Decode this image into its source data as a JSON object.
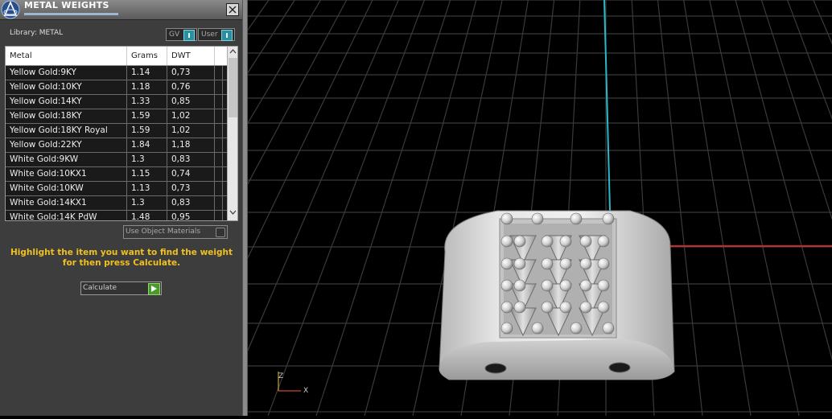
{
  "panel": {
    "title": "METAL WEIGHTS",
    "library_label": "Library: METAL",
    "toggles": {
      "gv": "GV",
      "user": "User"
    },
    "table": {
      "columns": [
        "Metal",
        "Grams",
        "DWT"
      ],
      "rows": [
        [
          "Yellow Gold:9KY",
          "1.14",
          "0,73"
        ],
        [
          "Yellow Gold:10KY",
          "1.18",
          "0,76"
        ],
        [
          "Yellow Gold:14KY",
          "1.33",
          "0,85"
        ],
        [
          "Yellow Gold:18KY",
          "1.59",
          "1,02"
        ],
        [
          "Yellow Gold:18KY Royal",
          "1.59",
          "1,02"
        ],
        [
          "Yellow Gold:22KY",
          "1.84",
          "1,18"
        ],
        [
          "White Gold:9KW",
          "1.3",
          "0,83"
        ],
        [
          "White Gold:10KX1",
          "1.15",
          "0,74"
        ],
        [
          "White Gold:10KW",
          "1.13",
          "0,73"
        ],
        [
          "White Gold:14KX1",
          "1.3",
          "0,83"
        ],
        [
          "White Gold:14K PdW",
          "1.48",
          "0,95"
        ]
      ]
    },
    "use_object_materials_label": "Use Object Materials",
    "hint_line1": "Highlight the item you want to find the weight",
    "hint_line2": "for then press Calculate.",
    "calculate_label": "Calculate"
  },
  "viewport": {
    "axis_labels": {
      "z": "Z",
      "x": "X"
    },
    "colors": {
      "axis_y": "#2ab8c8",
      "axis_x": "#c82a2a",
      "grid": "#3a3a3a"
    }
  },
  "icons": [
    "app-logo-icon",
    "close-icon",
    "scroll-up-icon",
    "scroll-down-icon",
    "play-icon",
    "axis-gizmo-icon"
  ]
}
